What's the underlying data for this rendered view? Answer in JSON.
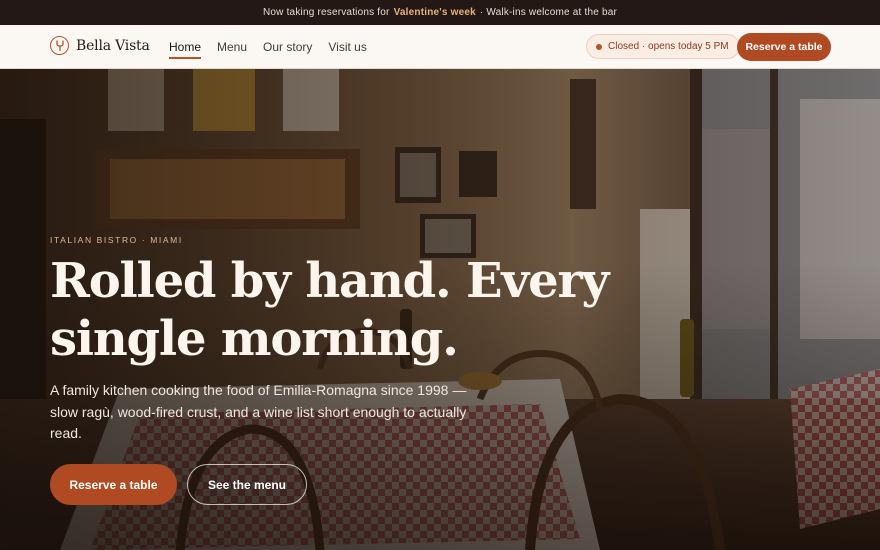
{
  "announcement": {
    "prefix": "Now taking reservations for",
    "highlight": "Valentine's week",
    "suffix": "· Walk-ins welcome at the bar"
  },
  "brand": {
    "name": "Bella Vista",
    "logo_icon": "fork-logo-icon"
  },
  "nav": {
    "links": [
      "Home",
      "Menu",
      "Our story",
      "Visit us"
    ],
    "active": "Home",
    "status": "Closed · opens today 5 PM",
    "cta": "Reserve a table"
  },
  "hero": {
    "eyebrow": "ITALIAN BISTRO · MIAMI",
    "headline_line1": "Rolled by hand. Every",
    "headline_line2": "single morning.",
    "subtitle": "A family kitchen cooking the food of Emilia-Romagna since 1998 — slow ragù, wood-fired crust, and a wine list short enough to actually read.",
    "primary_cta": "Reserve a table",
    "secondary_cta": "See the menu"
  },
  "colors": {
    "accent": "#b04a22",
    "announcement_bg": "#231815",
    "nav_bg": "#fbf8f4",
    "eyebrow": "#e0b889"
  }
}
